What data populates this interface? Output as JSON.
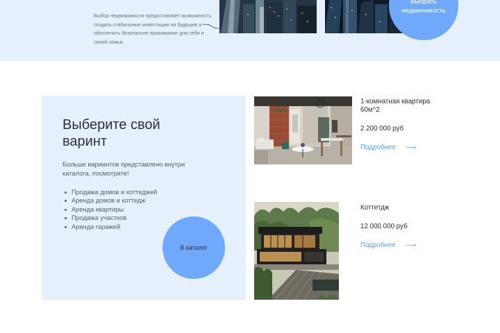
{
  "hero": {
    "text": "Выбор недвижимости предоставляет возможность создать стабильные инвестиции на будущее и обеспечить безопасное проживание для себя и своей семьи.",
    "cta_label": "Выбрать недвижимость",
    "accent_color": "#70a9fb",
    "background_color": "#e6f0fd"
  },
  "choose": {
    "title": "Выберите свой варинт",
    "subtitle": "Больше вариантов представлено внутри каталога, посмотрите!",
    "items": [
      "Продажа домов и коттеджей",
      "Аренда домов и коттедж",
      "Аренда квартиры",
      "Продажа участков",
      "Аренда гаражей"
    ],
    "catalog_button": "В каталог"
  },
  "listings": [
    {
      "title": "1-комнатная квартира 60м^2",
      "price": "2 200 000 руб",
      "link_label": "Подробнее",
      "photo_icon": "apartment-interior-photo"
    },
    {
      "title": "Коттетдж",
      "price": "12 000 000 руб",
      "link_label": "Подробнее",
      "photo_icon": "cottage-exterior-photo"
    }
  ],
  "link_color": "#5aa0f5"
}
